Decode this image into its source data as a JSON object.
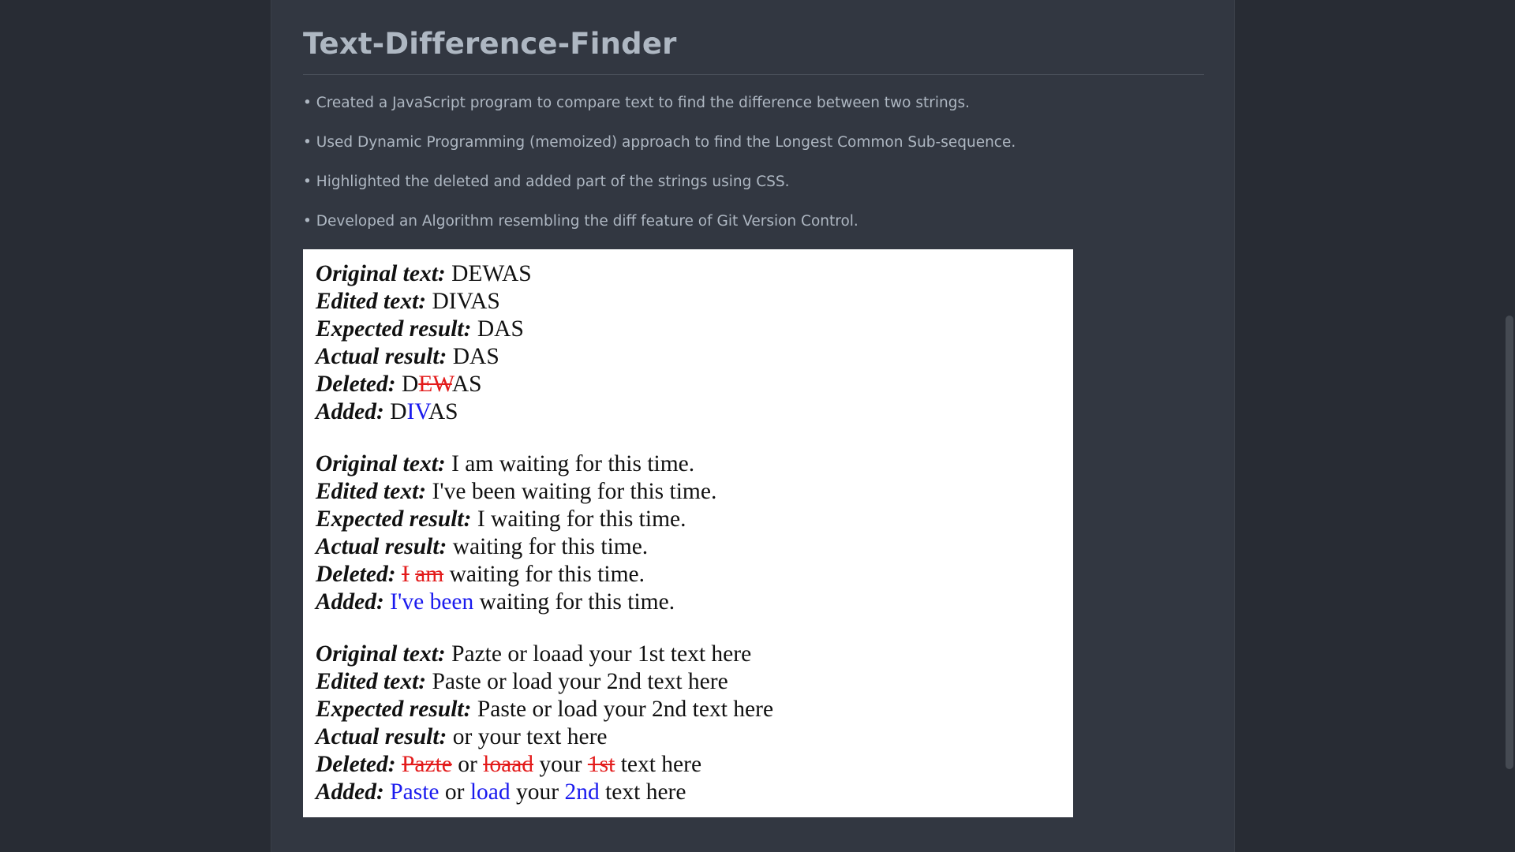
{
  "title": "Text-Difference-Finder",
  "bullets": [
    "• Created a JavaScript program to compare text to find the difference between two strings.",
    "• Used Dynamic Programming (memoized) approach to find the Longest Common Sub-sequence.",
    "• Highlighted the deleted and added part of the strings using CSS.",
    "• Developed an Algorithm resembling the diff feature of Git Version Control."
  ],
  "examples": [
    {
      "original_label": "Original text:",
      "original": " DEWAS",
      "edited_label": "Edited text:",
      "edited": " DIVAS",
      "expected_label": "Expected result:",
      "expected": " DAS",
      "actual_label": "Actual result:",
      "actual": " DAS",
      "deleted_label": "Deleted:",
      "deleted": [
        {
          "t": " D",
          "c": false
        },
        {
          "t": "EW",
          "c": true
        },
        {
          "t": "AS",
          "c": false
        }
      ],
      "added_label": "Added:",
      "added": [
        {
          "t": " D",
          "c": false
        },
        {
          "t": "IV",
          "c": true
        },
        {
          "t": "AS",
          "c": false
        }
      ]
    },
    {
      "original_label": "Original text:",
      "original": " I am waiting for this time.",
      "edited_label": "Edited text:",
      "edited": " I've been waiting for this time.",
      "expected_label": "Expected result:",
      "expected": " I waiting for this time.",
      "actual_label": "Actual result:",
      "actual": " waiting for this time.",
      "deleted_label": "Deleted:",
      "deleted": [
        {
          "t": " ",
          "c": false
        },
        {
          "t": "I",
          "c": true
        },
        {
          "t": " ",
          "c": false
        },
        {
          "t": "am",
          "c": true
        },
        {
          "t": " waiting for this time.",
          "c": false
        }
      ],
      "added_label": "Added:",
      "added": [
        {
          "t": " ",
          "c": false
        },
        {
          "t": "I've been",
          "c": true
        },
        {
          "t": " waiting for this time.",
          "c": false
        }
      ]
    },
    {
      "original_label": "Original text:",
      "original": " Pazte or loaad your 1st text here",
      "edited_label": "Edited text:",
      "edited": " Paste or load your 2nd text here",
      "expected_label": "Expected result:",
      "expected": " Paste or load your 2nd text here",
      "actual_label": "Actual result:",
      "actual": " or your text here",
      "deleted_label": "Deleted:",
      "deleted": [
        {
          "t": " ",
          "c": false
        },
        {
          "t": "Pazte",
          "c": true
        },
        {
          "t": " or ",
          "c": false
        },
        {
          "t": "loaad",
          "c": true
        },
        {
          "t": " your ",
          "c": false
        },
        {
          "t": "1st",
          "c": true
        },
        {
          "t": " text here",
          "c": false
        }
      ],
      "added_label": "Added:",
      "added": [
        {
          "t": " ",
          "c": false
        },
        {
          "t": "Paste",
          "c": true
        },
        {
          "t": " or ",
          "c": false
        },
        {
          "t": "load",
          "c": true
        },
        {
          "t": " your ",
          "c": false
        },
        {
          "t": "2nd",
          "c": true
        },
        {
          "t": " text here",
          "c": false
        }
      ]
    }
  ],
  "colors": {
    "page_bg": "#282c34",
    "panel_bg": "#323741",
    "text_muted": "#aeb7c2",
    "deleted": "#e31b1b",
    "added": "#1a1aee"
  }
}
